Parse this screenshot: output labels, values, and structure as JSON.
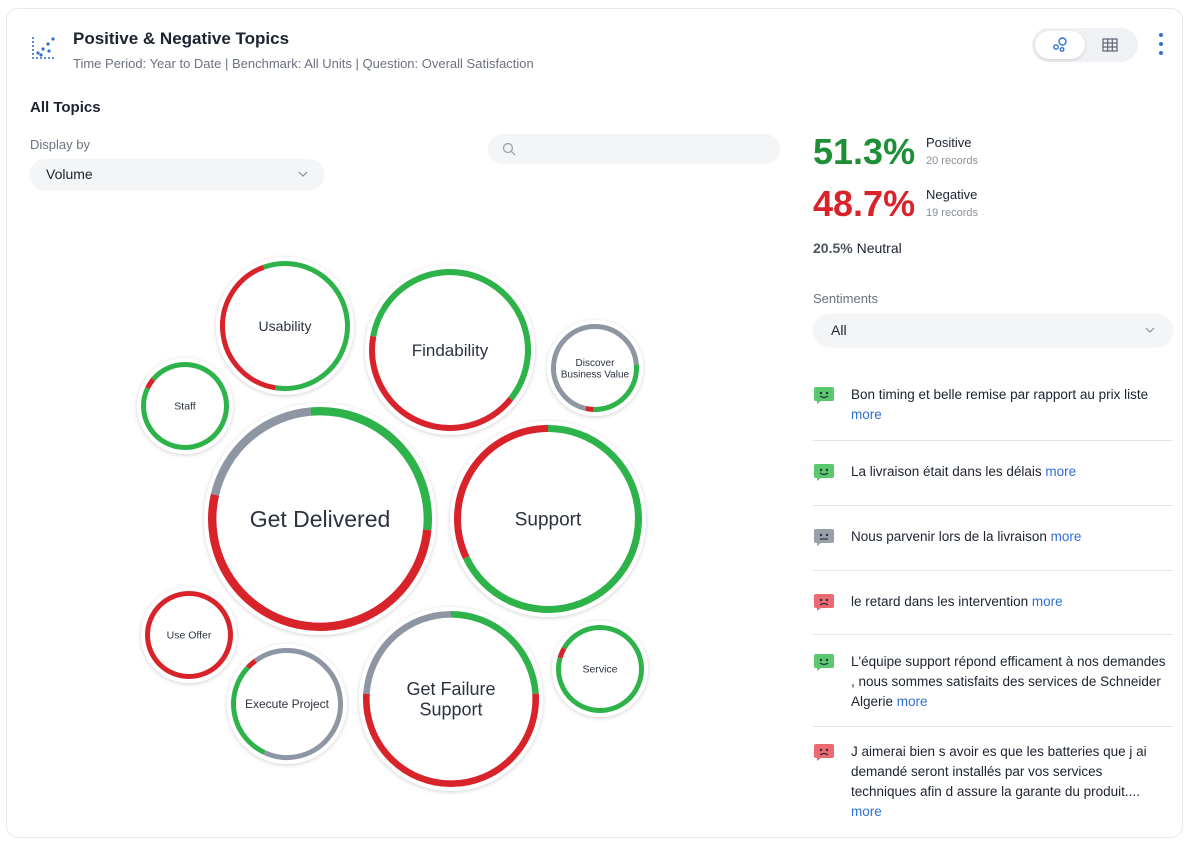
{
  "header": {
    "title": "Positive & Negative Topics",
    "subtitle": "Time Period: Year to Date | Benchmark: All Units | Question: Overall Satisfaction",
    "icon": "scatter-chart-icon",
    "view_options": [
      "bubble-view-icon",
      "table-view-icon"
    ],
    "active_view": "bubble",
    "menu_icon": "kebab-menu-icon"
  },
  "topics_section": {
    "title": "All Topics",
    "display_by_label": "Display by",
    "display_by_value": "Volume",
    "search_placeholder": ""
  },
  "colors": {
    "positive": "#2db34a",
    "negative": "#d8232a",
    "neutral": "#8e96a3",
    "link": "#2f6fd1"
  },
  "topics": [
    {
      "name": "Get Delivered",
      "positive": 0.28,
      "negative": 0.52,
      "neutral": 0.2
    },
    {
      "name": "Support",
      "positive": 0.68,
      "negative": 0.32,
      "neutral": 0.0
    },
    {
      "name": "Findability",
      "positive": 0.58,
      "negative": 0.42,
      "neutral": 0.0
    },
    {
      "name": "Get Failure Support",
      "positive": 0.24,
      "negative": 0.52,
      "neutral": 0.24
    },
    {
      "name": "Usability",
      "positive": 0.58,
      "negative": 0.42,
      "neutral": 0.0
    },
    {
      "name": "Discover Business Value",
      "positive": 0.27,
      "negative": 0.03,
      "neutral": 0.7
    },
    {
      "name": "Staff",
      "positive": 0.96,
      "negative": 0.04,
      "neutral": 0.0
    },
    {
      "name": "Use Offer",
      "positive": 0.0,
      "negative": 1.0,
      "neutral": 0.0
    },
    {
      "name": "Execute Project",
      "positive": 0.3,
      "negative": 0.03,
      "neutral": 0.67
    },
    {
      "name": "Service",
      "positive": 0.96,
      "negative": 0.04,
      "neutral": 0.0
    }
  ],
  "summary": {
    "positive_pct": "51.3%",
    "positive_label": "Positive",
    "positive_records": "20 records",
    "negative_pct": "48.7%",
    "negative_label": "Negative",
    "negative_records": "19 records",
    "neutral_pct": "20.5%",
    "neutral_label": "Neutral"
  },
  "sentiments": {
    "label": "Sentiments",
    "value": "All"
  },
  "comments": [
    {
      "sentiment": "positive",
      "text": "Bon timing et belle remise par rapport au prix liste",
      "more": "more"
    },
    {
      "sentiment": "positive",
      "text": "La livraison était dans les délais",
      "more": "more"
    },
    {
      "sentiment": "neutral",
      "text": "Nous parvenir lors de la livraison",
      "more": "more"
    },
    {
      "sentiment": "negative",
      "text": "le retard dans les intervention",
      "more": "more"
    },
    {
      "sentiment": "positive",
      "text": "L'équipe support répond efficament à nos demandes , nous sommes satisfaits des services de Schneider Algerie",
      "more": "more"
    },
    {
      "sentiment": "negative",
      "text": "J aimerai bien s avoir es que les batteries que j ai demandé seront installés par vos services techniques afin d assure la garante du produit....",
      "more": "more"
    }
  ]
}
